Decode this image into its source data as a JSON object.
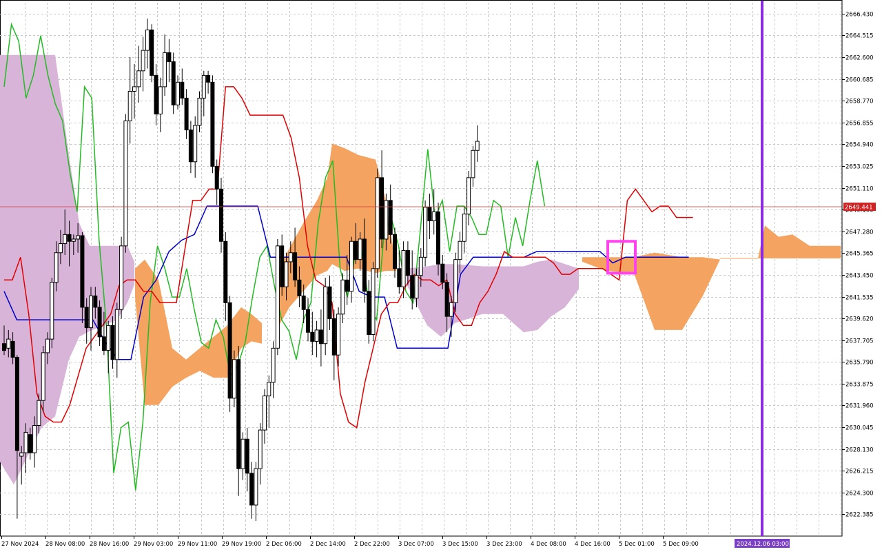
{
  "chart_data": {
    "type": "candlestick",
    "indicator": "Ichimoku Kinko Hyo",
    "ylim": [
      2620.47,
      2667.389
    ],
    "y_ticks": [
      "2666.430",
      "2664.515",
      "2662.600",
      "2660.685",
      "2658.770",
      "2656.855",
      "2654.940",
      "2653.025",
      "2651.110",
      "2649.195",
      "2647.280",
      "2645.365",
      "2643.450",
      "2641.535",
      "2639.620",
      "2637.705",
      "2635.790",
      "2633.875",
      "2631.960",
      "2630.045",
      "2628.130",
      "2626.215",
      "2624.300",
      "2622.385"
    ],
    "x_ticks": [
      "27 Nov 2024",
      "28 Nov 08:00",
      "28 Nov 16:00",
      "29 Nov 03:00",
      "29 Nov 11:00",
      "29 Nov 19:00",
      "2 Dec 06:00",
      "2 Dec 14:00",
      "2 Dec 22:00",
      "3 Dec 07:00",
      "3 Dec 15:00",
      "3 Dec 23:00",
      "4 Dec 08:00",
      "4 Dec 16:00",
      "5 Dec 01:00",
      "5 Dec 09:00"
    ],
    "current_price": "2649.441",
    "cursor_time_label": "2024.12.06 03:00",
    "grid": true,
    "colors": {
      "background": "#ffffff",
      "grid": "#c8c8c8",
      "bull_body": "#ffffff",
      "bear_body": "#000000",
      "tenkan": "#e00000",
      "kijun": "#0000c8",
      "chikou": "#22bb22",
      "kumo_bull": "#f4a460",
      "kumo_bear": "#d8b4d8",
      "price_line": "#d04040",
      "price_badge": "#d02020",
      "vline": "#8a2be2",
      "highlight_box": "#ff44ee"
    },
    "series": [
      {
        "values": [
          {
            "o": 2637.4,
            "h": 2639.0,
            "l": 2636.4,
            "c": 2636.8
          },
          {
            "o": 2637.0,
            "h": 2638.6,
            "l": 2636.2,
            "c": 2637.8
          },
          {
            "o": 2637.6,
            "h": 2638.4,
            "l": 2635.6,
            "c": 2636.2
          },
          {
            "o": 2636.2,
            "h": 2636.4,
            "l": 2622.0,
            "c": 2628.0
          },
          {
            "o": 2627.5,
            "h": 2628.4,
            "l": 2625.0,
            "c": 2627.8
          },
          {
            "o": 2627.8,
            "h": 2630.4,
            "l": 2626.0,
            "c": 2629.6
          },
          {
            "o": 2629.4,
            "h": 2630.0,
            "l": 2627.2,
            "c": 2627.8
          },
          {
            "o": 2627.8,
            "h": 2631.0,
            "l": 2626.5,
            "c": 2630.2
          },
          {
            "o": 2630.2,
            "h": 2633.0,
            "l": 2629.5,
            "c": 2632.4
          },
          {
            "o": 2632.4,
            "h": 2637.2,
            "l": 2631.4,
            "c": 2636.6
          },
          {
            "o": 2636.6,
            "h": 2638.4,
            "l": 2635.6,
            "c": 2637.8
          },
          {
            "o": 2637.8,
            "h": 2643.2,
            "l": 2637.0,
            "c": 2642.8
          },
          {
            "o": 2642.8,
            "h": 2646.4,
            "l": 2642.0,
            "c": 2645.4
          },
          {
            "o": 2645.4,
            "h": 2647.4,
            "l": 2644.4,
            "c": 2646.2
          },
          {
            "o": 2646.2,
            "h": 2649.2,
            "l": 2645.2,
            "c": 2647.0
          },
          {
            "o": 2647.0,
            "h": 2648.2,
            "l": 2644.2,
            "c": 2646.4
          },
          {
            "o": 2646.4,
            "h": 2647.0,
            "l": 2645.2,
            "c": 2646.6
          },
          {
            "o": 2646.6,
            "h": 2648.0,
            "l": 2645.4,
            "c": 2646.9
          },
          {
            "o": 2646.9,
            "h": 2647.2,
            "l": 2639.2,
            "c": 2640.6
          },
          {
            "o": 2640.6,
            "h": 2641.4,
            "l": 2637.4,
            "c": 2638.8
          },
          {
            "o": 2638.8,
            "h": 2642.4,
            "l": 2636.8,
            "c": 2641.6
          },
          {
            "o": 2641.6,
            "h": 2642.4,
            "l": 2639.6,
            "c": 2640.6
          },
          {
            "o": 2640.6,
            "h": 2641.2,
            "l": 2637.2,
            "c": 2638.0
          },
          {
            "o": 2638.0,
            "h": 2640.2,
            "l": 2636.4,
            "c": 2636.8
          },
          {
            "o": 2636.8,
            "h": 2639.4,
            "l": 2634.8,
            "c": 2639.0
          },
          {
            "o": 2639.0,
            "h": 2639.8,
            "l": 2635.2,
            "c": 2636.0
          },
          {
            "o": 2636.0,
            "h": 2641.0,
            "l": 2634.4,
            "c": 2640.4
          },
          {
            "o": 2640.4,
            "h": 2646.8,
            "l": 2639.6,
            "c": 2646.0
          },
          {
            "o": 2646.0,
            "h": 2657.6,
            "l": 2645.4,
            "c": 2657.0
          },
          {
            "o": 2657.0,
            "h": 2662.6,
            "l": 2655.0,
            "c": 2659.6
          },
          {
            "o": 2659.6,
            "h": 2662.0,
            "l": 2657.2,
            "c": 2660.0
          },
          {
            "o": 2660.0,
            "h": 2663.6,
            "l": 2658.6,
            "c": 2661.4
          },
          {
            "o": 2661.4,
            "h": 2664.4,
            "l": 2659.6,
            "c": 2663.2
          },
          {
            "o": 2663.2,
            "h": 2666.0,
            "l": 2661.6,
            "c": 2665.0
          },
          {
            "o": 2665.0,
            "h": 2665.5,
            "l": 2660.4,
            "c": 2661.0
          },
          {
            "o": 2661.0,
            "h": 2662.0,
            "l": 2656.6,
            "c": 2657.6
          },
          {
            "o": 2657.6,
            "h": 2660.8,
            "l": 2656.0,
            "c": 2660.0
          },
          {
            "o": 2660.0,
            "h": 2664.6,
            "l": 2659.2,
            "c": 2663.0
          },
          {
            "o": 2663.0,
            "h": 2664.2,
            "l": 2660.4,
            "c": 2662.2
          },
          {
            "o": 2662.2,
            "h": 2663.0,
            "l": 2657.6,
            "c": 2658.4
          },
          {
            "o": 2658.4,
            "h": 2661.0,
            "l": 2658.0,
            "c": 2660.4
          },
          {
            "o": 2660.4,
            "h": 2661.6,
            "l": 2658.4,
            "c": 2659.0
          },
          {
            "o": 2659.0,
            "h": 2659.8,
            "l": 2655.4,
            "c": 2656.2
          },
          {
            "o": 2656.2,
            "h": 2657.0,
            "l": 2652.4,
            "c": 2653.4
          },
          {
            "o": 2653.4,
            "h": 2657.4,
            "l": 2652.0,
            "c": 2656.6
          },
          {
            "o": 2656.6,
            "h": 2659.6,
            "l": 2656.0,
            "c": 2659.0
          },
          {
            "o": 2659.0,
            "h": 2661.4,
            "l": 2657.4,
            "c": 2661.0
          },
          {
            "o": 2661.0,
            "h": 2661.4,
            "l": 2659.4,
            "c": 2660.4
          },
          {
            "o": 2660.4,
            "h": 2661.0,
            "l": 2652.4,
            "c": 2653.0
          },
          {
            "o": 2653.0,
            "h": 2653.6,
            "l": 2649.6,
            "c": 2651.0
          },
          {
            "o": 2651.0,
            "h": 2652.0,
            "l": 2645.4,
            "c": 2646.4
          },
          {
            "o": 2646.4,
            "h": 2647.2,
            "l": 2639.4,
            "c": 2641.0
          },
          {
            "o": 2641.0,
            "h": 2641.6,
            "l": 2631.4,
            "c": 2632.6
          },
          {
            "o": 2632.6,
            "h": 2636.8,
            "l": 2631.8,
            "c": 2636.0
          },
          {
            "o": 2636.0,
            "h": 2637.2,
            "l": 2624.0,
            "c": 2626.4
          },
          {
            "o": 2626.4,
            "h": 2629.6,
            "l": 2625.4,
            "c": 2629.0
          },
          {
            "o": 2629.0,
            "h": 2630.0,
            "l": 2624.4,
            "c": 2626.0
          },
          {
            "o": 2626.0,
            "h": 2627.0,
            "l": 2622.0,
            "c": 2623.2
          },
          {
            "o": 2623.2,
            "h": 2627.0,
            "l": 2621.8,
            "c": 2626.4
          },
          {
            "o": 2626.4,
            "h": 2630.4,
            "l": 2625.0,
            "c": 2629.8
          },
          {
            "o": 2629.8,
            "h": 2633.4,
            "l": 2628.6,
            "c": 2632.8
          },
          {
            "o": 2632.8,
            "h": 2634.6,
            "l": 2630.0,
            "c": 2634.0
          },
          {
            "o": 2634.0,
            "h": 2637.6,
            "l": 2632.6,
            "c": 2637.0
          },
          {
            "o": 2637.0,
            "h": 2646.6,
            "l": 2636.4,
            "c": 2646.0
          },
          {
            "o": 2646.0,
            "h": 2647.0,
            "l": 2641.6,
            "c": 2642.4
          },
          {
            "o": 2642.4,
            "h": 2645.4,
            "l": 2641.2,
            "c": 2644.6
          },
          {
            "o": 2644.6,
            "h": 2646.4,
            "l": 2643.6,
            "c": 2645.4
          },
          {
            "o": 2645.4,
            "h": 2647.6,
            "l": 2642.4,
            "c": 2643.0
          },
          {
            "o": 2643.0,
            "h": 2644.2,
            "l": 2640.6,
            "c": 2641.6
          },
          {
            "o": 2641.6,
            "h": 2642.6,
            "l": 2639.2,
            "c": 2640.4
          },
          {
            "o": 2640.4,
            "h": 2641.4,
            "l": 2637.6,
            "c": 2638.4
          },
          {
            "o": 2638.4,
            "h": 2640.2,
            "l": 2636.4,
            "c": 2637.6
          },
          {
            "o": 2637.6,
            "h": 2639.4,
            "l": 2636.2,
            "c": 2638.6
          },
          {
            "o": 2638.6,
            "h": 2640.4,
            "l": 2635.4,
            "c": 2637.4
          },
          {
            "o": 2637.4,
            "h": 2643.2,
            "l": 2636.4,
            "c": 2642.4
          },
          {
            "o": 2642.4,
            "h": 2643.4,
            "l": 2638.6,
            "c": 2639.6
          },
          {
            "o": 2639.6,
            "h": 2640.4,
            "l": 2634.2,
            "c": 2636.4
          },
          {
            "o": 2636.4,
            "h": 2640.6,
            "l": 2635.4,
            "c": 2640.0
          },
          {
            "o": 2640.0,
            "h": 2643.6,
            "l": 2639.2,
            "c": 2643.0
          },
          {
            "o": 2643.0,
            "h": 2645.2,
            "l": 2640.8,
            "c": 2642.0
          },
          {
            "o": 2642.0,
            "h": 2646.8,
            "l": 2641.0,
            "c": 2646.4
          },
          {
            "o": 2646.4,
            "h": 2648.0,
            "l": 2644.4,
            "c": 2644.8
          },
          {
            "o": 2644.8,
            "h": 2647.2,
            "l": 2643.8,
            "c": 2646.6
          },
          {
            "o": 2646.6,
            "h": 2648.4,
            "l": 2641.0,
            "c": 2642.0
          },
          {
            "o": 2642.0,
            "h": 2643.0,
            "l": 2637.4,
            "c": 2638.2
          },
          {
            "o": 2638.2,
            "h": 2644.6,
            "l": 2637.6,
            "c": 2644.0
          },
          {
            "o": 2644.0,
            "h": 2652.8,
            "l": 2643.2,
            "c": 2652.0
          },
          {
            "o": 2652.0,
            "h": 2654.4,
            "l": 2645.8,
            "c": 2646.6
          },
          {
            "o": 2646.6,
            "h": 2650.6,
            "l": 2645.6,
            "c": 2650.0
          },
          {
            "o": 2650.0,
            "h": 2651.4,
            "l": 2646.2,
            "c": 2647.0
          },
          {
            "o": 2647.0,
            "h": 2647.6,
            "l": 2643.2,
            "c": 2644.0
          },
          {
            "o": 2644.0,
            "h": 2645.6,
            "l": 2641.8,
            "c": 2642.4
          },
          {
            "o": 2642.4,
            "h": 2646.4,
            "l": 2641.4,
            "c": 2645.6
          },
          {
            "o": 2645.6,
            "h": 2646.4,
            "l": 2642.6,
            "c": 2643.4
          },
          {
            "o": 2643.4,
            "h": 2645.6,
            "l": 2640.4,
            "c": 2641.4
          },
          {
            "o": 2641.4,
            "h": 2644.0,
            "l": 2640.6,
            "c": 2643.4
          },
          {
            "o": 2643.4,
            "h": 2645.8,
            "l": 2642.4,
            "c": 2645.0
          },
          {
            "o": 2645.0,
            "h": 2650.0,
            "l": 2644.2,
            "c": 2649.4
          },
          {
            "o": 2649.4,
            "h": 2650.6,
            "l": 2646.6,
            "c": 2648.2
          },
          {
            "o": 2648.2,
            "h": 2651.0,
            "l": 2647.0,
            "c": 2649.0
          },
          {
            "o": 2649.0,
            "h": 2649.8,
            "l": 2643.4,
            "c": 2644.4
          },
          {
            "o": 2644.4,
            "h": 2645.2,
            "l": 2642.2,
            "c": 2642.8
          },
          {
            "o": 2642.8,
            "h": 2643.6,
            "l": 2638.4,
            "c": 2639.8
          },
          {
            "o": 2639.8,
            "h": 2641.6,
            "l": 2638.0,
            "c": 2641.0
          },
          {
            "o": 2641.0,
            "h": 2645.4,
            "l": 2640.2,
            "c": 2644.8
          },
          {
            "o": 2644.8,
            "h": 2647.2,
            "l": 2643.6,
            "c": 2646.4
          },
          {
            "o": 2646.4,
            "h": 2649.4,
            "l": 2645.4,
            "c": 2648.8
          },
          {
            "o": 2648.8,
            "h": 2652.6,
            "l": 2647.8,
            "c": 2652.0
          },
          {
            "o": 2652.0,
            "h": 2654.8,
            "l": 2651.2,
            "c": 2654.4
          },
          {
            "o": 2654.4,
            "h": 2656.6,
            "l": 2653.4,
            "c": 2655.2
          }
        ]
      },
      {
        "values": [
          2643.0,
          2643.0,
          2645.0,
          2640.0,
          2633.0,
          2631.0,
          2630.5,
          2630.5,
          2632.0,
          2634.5,
          2637.0,
          2638.0,
          2639.0,
          2640.0,
          2642.5,
          2643.0,
          2643.0,
          2642.0,
          2642.0,
          2641.0,
          2641.0,
          2641.0,
          2645.5,
          2650.0,
          2650.0,
          2651.0,
          2651.0,
          2660.0,
          2660.0,
          2659.0,
          2657.5,
          2657.5,
          2657.5,
          2657.5,
          2657.5,
          2655.5,
          2652.0,
          2646.0,
          2643.0,
          2642.5,
          2641.0,
          2633.0,
          2630.5,
          2630.0,
          2634.0,
          2637.0,
          2640.0,
          2641.0,
          2641.0,
          2642.5,
          2643.5,
          2643.0,
          2643.0,
          2642.5,
          2643.0,
          2640.0,
          2639.0,
          2639.0,
          2641.0,
          2642.0,
          2643.5,
          2645.5,
          2645.0,
          2645.0,
          2645.0,
          2645.0,
          2645.0,
          2644.5,
          2643.5,
          2643.5,
          2644.0,
          2644.0,
          2644.0,
          2644.0,
          2643.5,
          2643.0,
          2650.0,
          2651.0,
          2650.0,
          2649.0,
          2649.5,
          2649.5,
          2648.5,
          2648.5,
          2648.5
        ]
      },
      {
        "values": [
          2642.0,
          2639.5,
          2639.5,
          2639.5,
          2639.5,
          2639.5,
          2639.5,
          2639.5,
          2637.5,
          2636.0,
          2636.0,
          2641.5,
          2643.0,
          2645.5,
          2646.5,
          2647.0,
          2649.5,
          2649.5,
          2649.5,
          2649.5,
          2649.5,
          2645.0,
          2645.0,
          2645.0,
          2645.0,
          2645.0,
          2645.0,
          2645.0,
          2642.0,
          2641.5,
          2641.5,
          2637.0,
          2637.0,
          2637.0,
          2637.0,
          2637.0,
          2643.5,
          2645.0,
          2645.0,
          2645.0,
          2645.0,
          2645.0,
          2645.5,
          2645.5,
          2645.5,
          2645.5,
          2645.5,
          2645.5,
          2644.5,
          2645.0,
          2645.0,
          2645.0,
          2645.0,
          2645.0,
          2645.0
        ]
      },
      {
        "values": [
          2660.0,
          2665.5,
          2664.0,
          2659.0,
          2661.0,
          2664.5,
          2661.0,
          2658.5,
          2657.0,
          2652.5,
          2649.0,
          2660.0,
          2659.0,
          2646.5,
          2639.0,
          2626.0,
          2630.0,
          2630.5,
          2624.5,
          2630.5,
          2641.0,
          2646.0,
          2644.0,
          2641.5,
          2641.5,
          2644.0,
          2640.5,
          2637.5,
          2637.0,
          2639.5,
          2638.0,
          2634.5,
          2635.5,
          2637.5,
          2641.5,
          2645.0,
          2646.0,
          2642.5,
          2639.5,
          2638.5,
          2636.0,
          2639.5,
          2641.0,
          2648.0,
          2652.0,
          2653.5,
          2644.0,
          2641.5,
          2645.0,
          2645.5,
          2640.5,
          2639.5,
          2647.0,
          2648.5,
          2646.0,
          2642.0,
          2641.0,
          2647.5,
          2654.5,
          2648.5,
          2650.0,
          2645.5,
          2649.5,
          2649.5,
          2648.5,
          2647.0,
          2647.0,
          2650.0,
          2649.5,
          2645.0,
          2648.5,
          2646.0,
          2650.0,
          2653.5,
          2649.5
        ]
      }
    ]
  }
}
